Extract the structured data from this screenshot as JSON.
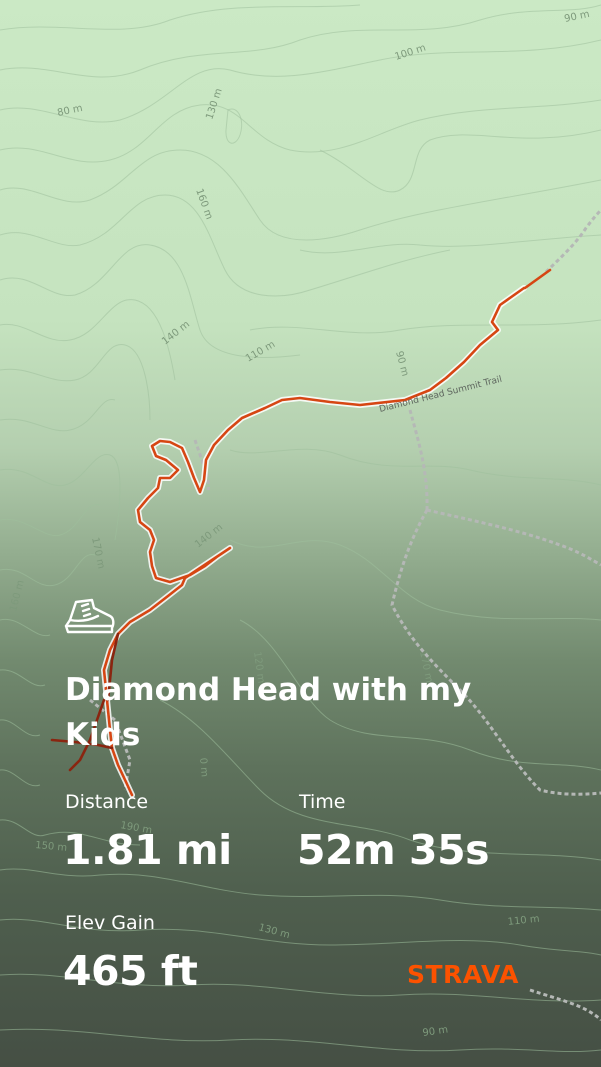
{
  "activity": {
    "type_icon": "hiking-boot-icon",
    "title": "Diamond Head with my Kids"
  },
  "stats": {
    "distance": {
      "label": "Distance",
      "value": "1.81 mi"
    },
    "time": {
      "label": "Time",
      "value": "52m 35s"
    },
    "elev_gain": {
      "label": "Elev Gain",
      "value": "465 ft"
    }
  },
  "brand": {
    "name": "STRAVA",
    "color": "#fc5200"
  },
  "map": {
    "route_color": "#d64613",
    "contour_labels": [
      "90 m",
      "100 m",
      "80 m",
      "130 m",
      "160 m",
      "140 m",
      "110 m",
      "90 m",
      "140 m",
      "170 m",
      "160 m",
      "120 m",
      "170 m",
      "190 m",
      "150 m",
      "130 m",
      "110 m",
      "90 m"
    ],
    "trail_label": "Diamond Head Summit Trail"
  }
}
